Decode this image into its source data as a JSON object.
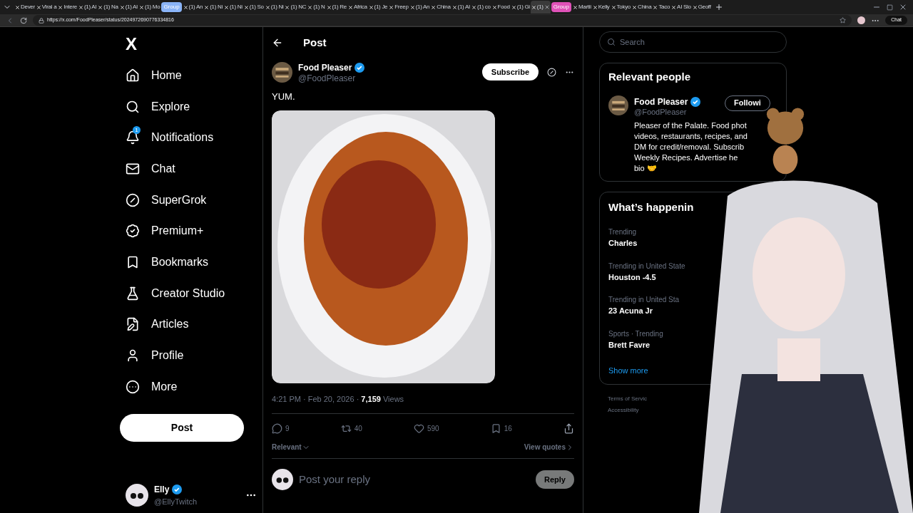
{
  "browser": {
    "tabs": [
      {
        "kind": "tab",
        "label": "Dever",
        "selected": false
      },
      {
        "kind": "tab",
        "label": "Viral a",
        "selected": false
      },
      {
        "kind": "tab",
        "label": "Intere",
        "selected": false
      },
      {
        "kind": "tab",
        "label": "(1) AI",
        "selected": false
      },
      {
        "kind": "tab",
        "label": "(1) Na",
        "selected": false
      },
      {
        "kind": "tab",
        "label": "(1) AI",
        "selected": false
      },
      {
        "kind": "tab",
        "label": "(1) Mo",
        "selected": false
      },
      {
        "kind": "group",
        "label": "Group",
        "color": "#8ab4f8"
      },
      {
        "kind": "tab",
        "label": "(1) An",
        "selected": false
      },
      {
        "kind": "tab",
        "label": "(1) Ni",
        "selected": false
      },
      {
        "kind": "tab",
        "label": "(1) Ni",
        "selected": false
      },
      {
        "kind": "tab",
        "label": "(1) So",
        "selected": false
      },
      {
        "kind": "tab",
        "label": "(1) Ni",
        "selected": false
      },
      {
        "kind": "tab",
        "label": "(1) NC",
        "selected": false
      },
      {
        "kind": "tab",
        "label": "(1) N",
        "selected": false
      },
      {
        "kind": "tab",
        "label": "(1) Re",
        "selected": false
      },
      {
        "kind": "tab",
        "label": "Africa",
        "selected": false
      },
      {
        "kind": "tab",
        "label": "(1) Je",
        "selected": false
      },
      {
        "kind": "tab",
        "label": "Freep",
        "selected": false
      },
      {
        "kind": "tab",
        "label": "(1) An",
        "selected": false
      },
      {
        "kind": "tab",
        "label": "China",
        "selected": false
      },
      {
        "kind": "tab",
        "label": "(1) AI",
        "selected": false
      },
      {
        "kind": "tab",
        "label": "(1) co",
        "selected": false
      },
      {
        "kind": "tab",
        "label": "Food",
        "selected": false
      },
      {
        "kind": "tab",
        "label": "(1) Gi",
        "selected": false
      },
      {
        "kind": "tab",
        "label": "(1)",
        "selected": true
      },
      {
        "kind": "group",
        "label": "Group",
        "color": "#e052b8"
      },
      {
        "kind": "tab",
        "label": "Martii",
        "selected": false
      },
      {
        "kind": "tab",
        "label": "Kelly",
        "selected": false
      },
      {
        "kind": "tab",
        "label": "Tokyo",
        "selected": false
      },
      {
        "kind": "tab",
        "label": "China",
        "selected": false
      },
      {
        "kind": "tab",
        "label": "Taco",
        "selected": false
      },
      {
        "kind": "tab",
        "label": "AI Slo",
        "selected": false
      },
      {
        "kind": "tab",
        "label": "Geoff",
        "selected": false
      }
    ],
    "url": "https://x.com/FoodPleaser/status/2024972690776334816",
    "chat_button": "Chat"
  },
  "nav": {
    "logo": "X",
    "items": [
      {
        "label": "Home"
      },
      {
        "label": "Explore"
      },
      {
        "label": "Notifications",
        "badge": "1"
      },
      {
        "label": "Chat"
      },
      {
        "label": "SuperGrok"
      },
      {
        "label": "Premium+"
      },
      {
        "label": "Bookmarks"
      },
      {
        "label": "Creator Studio"
      },
      {
        "label": "Articles"
      },
      {
        "label": "Profile"
      },
      {
        "label": "More"
      }
    ],
    "post_button": "Post",
    "account": {
      "name": "Elly",
      "handle": "@EllyTwitch",
      "verified": true
    }
  },
  "post": {
    "header": "Post",
    "author": {
      "name": "Food Pleaser",
      "handle": "@FoodPleaser",
      "verified": true
    },
    "subscribe_button": "Subscribe",
    "text": "YUM.",
    "meta": {
      "time": "4:21 PM · Feb 20, 2026 · ",
      "views_count": "7,159",
      "views_label": " Views"
    },
    "actions": [
      {
        "count": "9"
      },
      {
        "count": "40"
      },
      {
        "count": "590"
      },
      {
        "count": "16"
      }
    ],
    "sort": "Relevant",
    "view_quotes": "View quotes",
    "reply": {
      "placeholder": "Post your reply",
      "button": "Reply"
    }
  },
  "sidebar": {
    "search": {
      "placeholder": "Search"
    },
    "relevant_people": {
      "title": "Relevant people",
      "person": {
        "name": "Food Pleaser",
        "handle": "@FoodPleaser",
        "verified": true,
        "follow_button": "Followi",
        "bio_lines": [
          "Pleaser of the Palate. Food phot",
          "videos, restaurants, recipes, and",
          "DM for credit/removal. Subscrib",
          "Weekly Recipes. Advertise he",
          "bio 🤝"
        ]
      }
    },
    "trends": {
      "title": "What’s happenin",
      "items": [
        {
          "context": "Trending",
          "name": "Charles"
        },
        {
          "context": "Trending in United State",
          "name": "Houston -4.5"
        },
        {
          "context": "Trending in United Sta",
          "name": "23 Acuna Jr"
        },
        {
          "context": "Sports · Trending",
          "name": "Brett Favre"
        }
      ],
      "show_more": "Show more"
    },
    "footer": [
      "Terms of Servic",
      "Accessibility"
    ]
  }
}
